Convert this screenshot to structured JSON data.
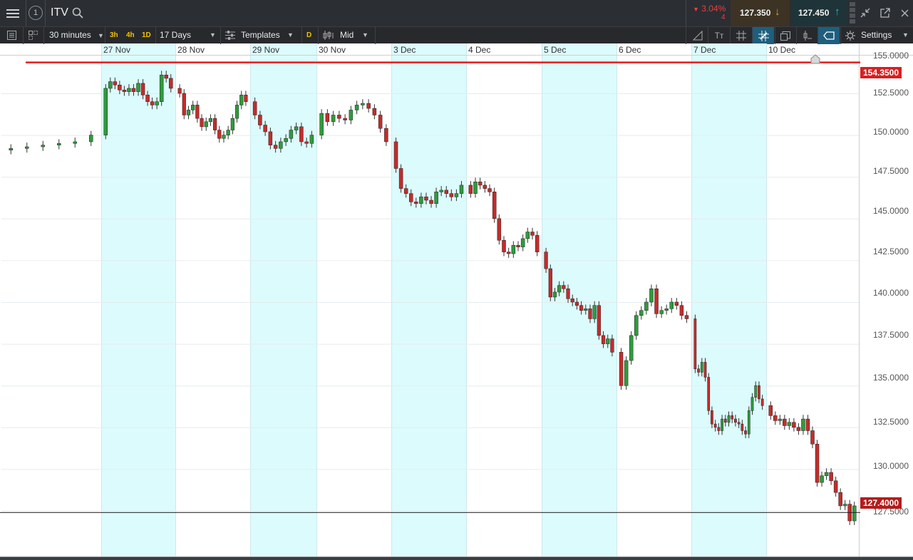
{
  "header": {
    "symbol": "ITV",
    "change_pct": "3.04%",
    "change_sub": "4",
    "sell_price": "127.350",
    "buy_price": "127.450",
    "badge": "1"
  },
  "toolbar": {
    "interval": "30 minutes",
    "q3h": "3h",
    "q4h": "4h",
    "q1d": "1D",
    "range": "17 Days",
    "templates": "Templates",
    "d_label": "D",
    "price_type": "Mid",
    "settings": "Settings"
  },
  "chart": {
    "dates": [
      {
        "label": "27 Nov"
      },
      {
        "label": "28 Nov"
      },
      {
        "label": "29 Nov"
      },
      {
        "label": "30 Nov"
      },
      {
        "label": "3 Dec"
      },
      {
        "label": "4 Dec"
      },
      {
        "label": "5 Dec"
      },
      {
        "label": "6 Dec"
      },
      {
        "label": "7 Dec"
      },
      {
        "label": "10 Dec"
      }
    ],
    "price_axis": [
      "155.0000",
      "152.5000",
      "150.0000",
      "147.5000",
      "145.0000",
      "142.5000",
      "140.0000",
      "137.5000",
      "135.0000",
      "132.5000",
      "130.0000",
      "127.5000"
    ],
    "resistance_label": "154.3500",
    "current_label": "127.4000",
    "colors": {
      "up": "#2e9c3c",
      "down": "#c62b2b",
      "shade": "#dcfbfd",
      "resistance": "#e01e1e"
    }
  },
  "chart_data": {
    "type": "candlestick",
    "interval": "30 minutes",
    "ylim": [
      126.5,
      155.2
    ],
    "horizontal_lines": [
      154.35,
      127.4
    ],
    "closes": [
      [
        149.2,
        149.3,
        149.4,
        149.5,
        149.6,
        150.0
      ],
      [
        152.8,
        153.2,
        153.0,
        152.7,
        152.6,
        152.8,
        152.6,
        153.1,
        152.4,
        152.0,
        151.8,
        152.0,
        153.6,
        153.4,
        152.8
      ],
      [
        152.5,
        151.2,
        151.5,
        151.8,
        151.0,
        150.5,
        150.8,
        151.0,
        150.3,
        149.8,
        150.0,
        150.3,
        151.0,
        151.8,
        152.4,
        152.0
      ],
      [
        151.2,
        150.6,
        150.2,
        149.4,
        149.2,
        149.6,
        149.8,
        150.3,
        150.5,
        149.6,
        149.5,
        150.0
      ],
      [
        151.3,
        150.8,
        151.2,
        151.0,
        150.9,
        151.5,
        151.8,
        151.9,
        151.6,
        151.2,
        150.4,
        149.6
      ],
      [
        148.0,
        146.8,
        146.5,
        146.0,
        145.9,
        146.3,
        146.1,
        145.9,
        146.6,
        146.7,
        146.5,
        146.3,
        146.5,
        147.0
      ],
      [
        146.5,
        147.2,
        147.0,
        146.8,
        146.6,
        145.0,
        143.7,
        143.0,
        142.9,
        143.4,
        143.3,
        143.8,
        144.2,
        144.0,
        143.0
      ],
      [
        142.0,
        140.3,
        140.6,
        141.0,
        140.8,
        140.2,
        140.0,
        139.8,
        139.5,
        139.6,
        139.0,
        139.8,
        138.0,
        137.5,
        137.8,
        137.0
      ],
      [
        135.0,
        136.5,
        138.0,
        139.2,
        139.5,
        140.0,
        140.8,
        139.3,
        139.5,
        139.6,
        140.0,
        139.8,
        139.2,
        139.0
      ],
      [
        136.0,
        135.8,
        136.4,
        135.5,
        133.5,
        132.7,
        132.5,
        132.3,
        133.0,
        132.8,
        133.2,
        133.0,
        132.8,
        132.7,
        132.3,
        132.1,
        133.5,
        134.3,
        135.0,
        134.2,
        133.8
      ],
      [
        133.2,
        132.9,
        133.0,
        132.6,
        132.8,
        132.5,
        132.3,
        133.0,
        132.3,
        131.5,
        129.2,
        129.6,
        129.8,
        129.3,
        128.6,
        127.8,
        127.9,
        126.9,
        127.8
      ]
    ]
  }
}
